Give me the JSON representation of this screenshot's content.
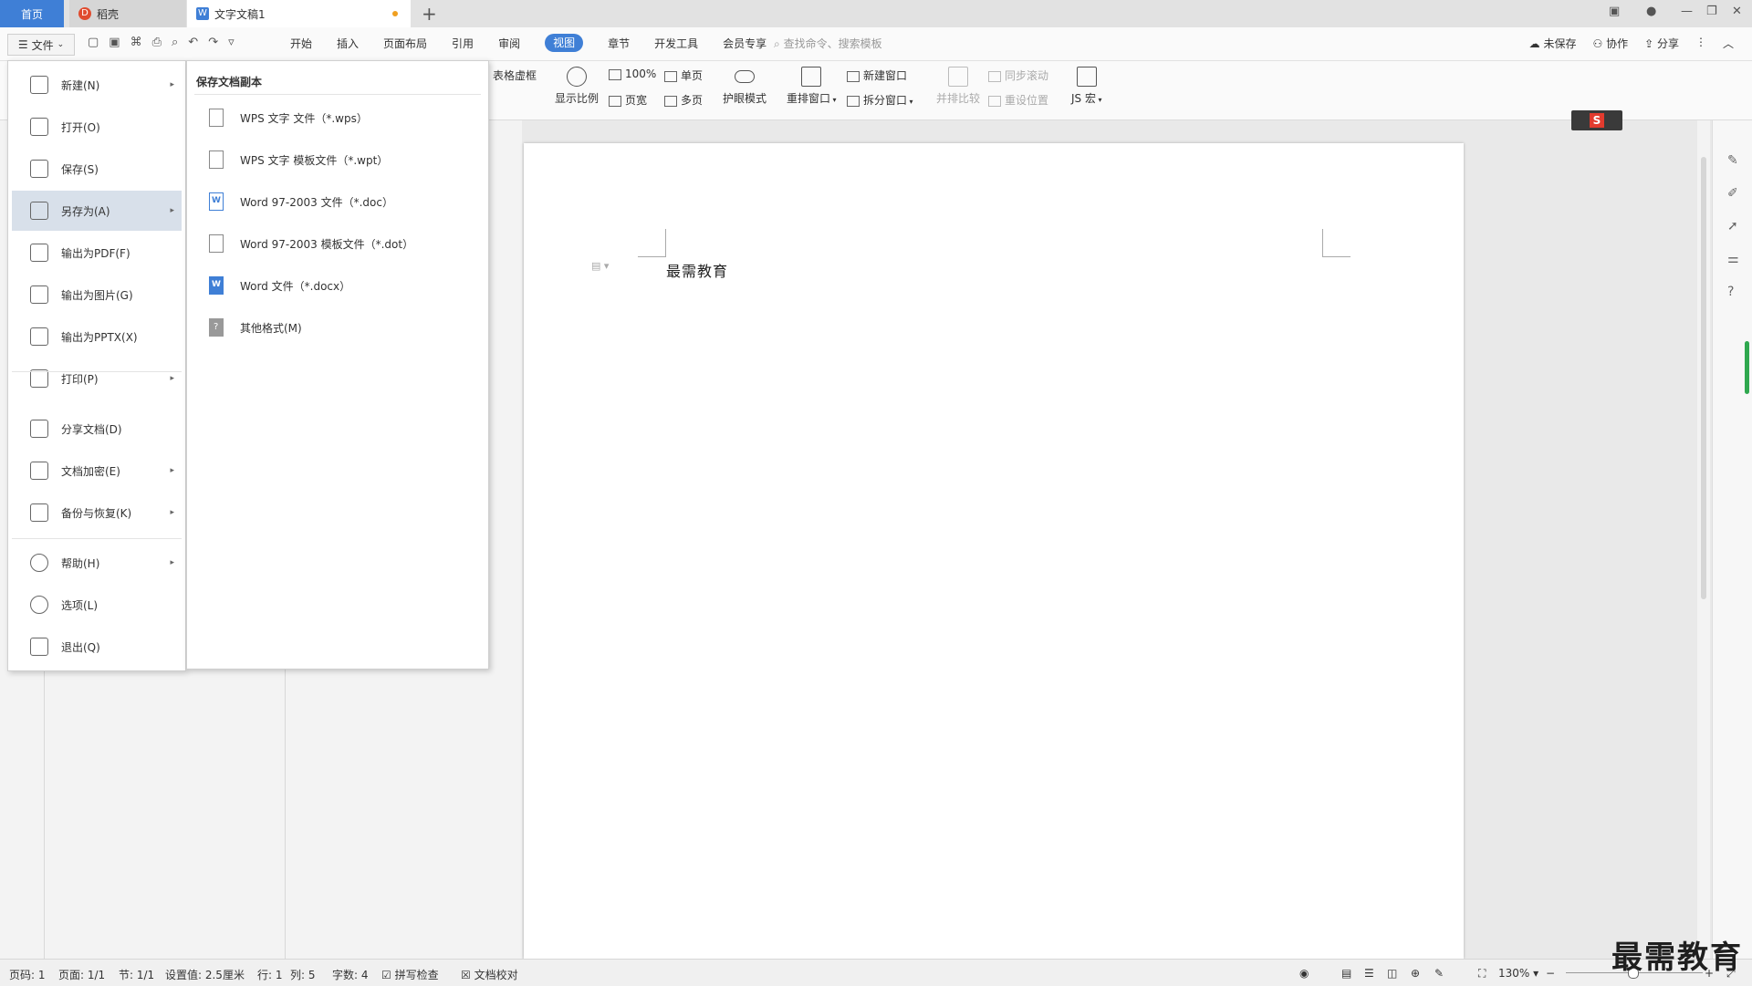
{
  "tabs": {
    "home": "首页",
    "docer": "稻壳",
    "doc": "文字文稿1"
  },
  "menubar": {
    "file_label": "文件",
    "tabs": [
      "开始",
      "插入",
      "页面布局",
      "引用",
      "审阅",
      "视图",
      "章节",
      "开发工具",
      "会员专享"
    ],
    "active_tab": "视图",
    "search_placeholder": "查找命令、搜索模板",
    "right": [
      "未保存",
      "协作",
      "分享"
    ]
  },
  "ribbon": {
    "table_outline": "表格虚框",
    "zoom_display": "显示比例",
    "zoom_100": "100%",
    "page_width": "页宽",
    "single_page": "单页",
    "multi_page": "多页",
    "eye_mode": "护眼模式",
    "rearrange": "重排窗口",
    "new_window": "新建窗口",
    "split_window": "拆分窗口",
    "side_compare": "并排比较",
    "sync_scroll": "同步滚动",
    "reset_pos": "重设位置",
    "js_macro": "JS 宏"
  },
  "file_menu": {
    "items": [
      {
        "label": "新建(N)",
        "icon": "new-doc-icon"
      },
      {
        "label": "打开(O)",
        "icon": "folder-open-icon"
      },
      {
        "label": "保存(S)",
        "icon": "save-icon"
      },
      {
        "label": "另存为(A)",
        "icon": "save-as-icon"
      },
      {
        "label": "输出为PDF(F)",
        "icon": "pdf-icon"
      },
      {
        "label": "输出为图片(G)",
        "icon": "image-icon"
      },
      {
        "label": "输出为PPTX(X)",
        "icon": "pptx-icon"
      },
      {
        "label": "打印(P)",
        "icon": "print-icon"
      },
      {
        "label": "分享文档(D)",
        "icon": "share-icon"
      },
      {
        "label": "文档加密(E)",
        "icon": "encrypt-icon"
      },
      {
        "label": "备份与恢复(K)",
        "icon": "backup-icon"
      },
      {
        "label": "帮助(H)",
        "icon": "help-icon"
      },
      {
        "label": "选项(L)",
        "icon": "gear-icon"
      },
      {
        "label": "退出(Q)",
        "icon": "exit-icon"
      }
    ],
    "active": "另存为(A)"
  },
  "save_as_submenu": {
    "title": "保存文档副本",
    "items": [
      "WPS 文字 文件（*.wps）",
      "WPS 文字 模板文件（*.wpt）",
      "Word 97-2003 文件（*.doc）",
      "Word 97-2003 模板文件（*.dot）",
      "Word 文件（*.docx）",
      "其他格式(M)"
    ]
  },
  "document": {
    "text": "最需教育"
  },
  "status": {
    "page_num": "页码: 1",
    "pages": "页面: 1/1",
    "section": "节: 1/1",
    "setting": "设置值: 2.5厘米",
    "row": "行: 1",
    "col": "列: 5",
    "words": "字数: 4",
    "spell": "拼写检查",
    "proof": "文档校对",
    "zoom": "130%"
  },
  "watermark": "最需教育",
  "colors": {
    "accent": "#3f7fd6",
    "menu_highlight": "#d8e0ea",
    "green_indicator": "#2fa84f"
  }
}
